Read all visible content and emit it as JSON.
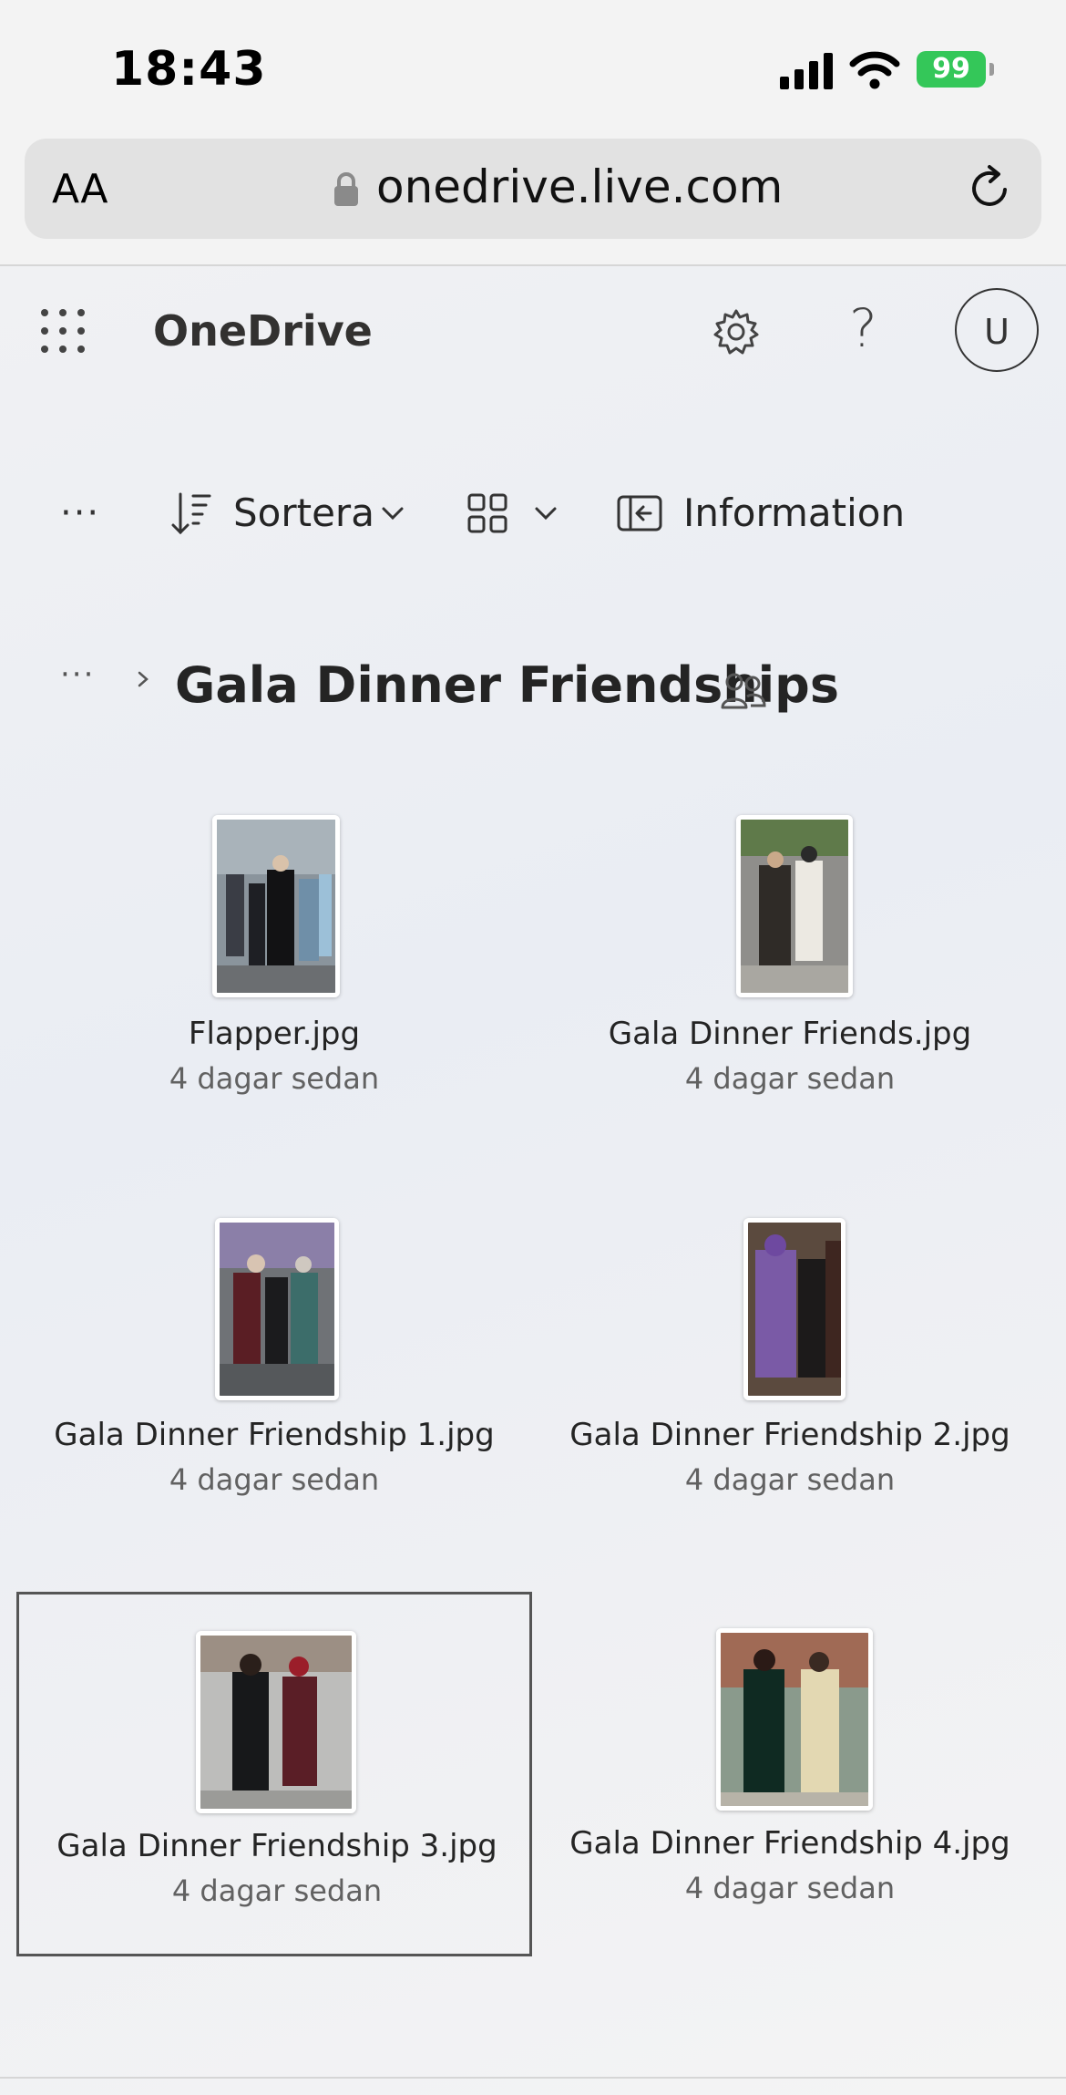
{
  "status_bar": {
    "time": "18:43",
    "battery": "99"
  },
  "browser": {
    "text_size_label": "AA",
    "url": "onedrive.live.com"
  },
  "header": {
    "app_name": "OneDrive",
    "help_label": "?",
    "avatar_initial": "U"
  },
  "toolbar": {
    "more_label": "···",
    "sort_label": "Sortera",
    "info_label": "Information"
  },
  "breadcrumb": {
    "more_label": "···",
    "folder_title": "Gala Dinner Friendships"
  },
  "files": [
    {
      "name": "Flapper.jpg",
      "modified": "4 dagar sedan",
      "selected": false
    },
    {
      "name": "Gala Dinner Friends.jpg",
      "modified": "4 dagar sedan",
      "selected": false
    },
    {
      "name": "Gala Dinner Friendship 1.jpg",
      "modified": "4 dagar sedan",
      "selected": false
    },
    {
      "name": "Gala Dinner Friendship 2.jpg",
      "modified": "4 dagar sedan",
      "selected": false
    },
    {
      "name": "Gala Dinner Friendship 3.jpg",
      "modified": "4 dagar sedan",
      "selected": true
    },
    {
      "name": "Gala Dinner Friendship 4.jpg",
      "modified": "4 dagar sedan",
      "selected": false
    }
  ],
  "icons": [
    "signal-icon",
    "wifi-icon",
    "battery-icon",
    "lock-icon",
    "reload-icon",
    "app-launcher-icon",
    "settings-icon",
    "sort-icon",
    "chevron-down-icon",
    "view-grid-icon",
    "info-pane-icon",
    "chevron-right-icon",
    "shared-people-icon"
  ],
  "colors": {
    "battery_green": "#34c759",
    "text": "#242424",
    "muted": "#616161"
  }
}
